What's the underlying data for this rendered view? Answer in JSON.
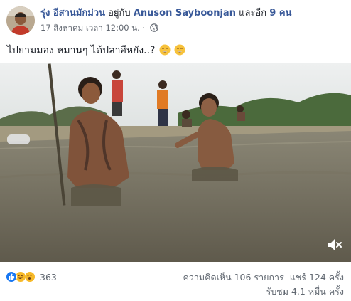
{
  "post": {
    "author": "รุ่ง อีสานมักม่วน",
    "with_text": "อยู่กับ",
    "tagged_name": "Anuson Sayboonjan",
    "and_text": "และอีก",
    "others_link": "9 คน",
    "timestamp": "17 สิงหาคม เวลา 12:00 น. ·",
    "privacy_icon": "globe-icon",
    "text": "ไปยามมอง หมานๆ ได้ปลาอีหยัง..?"
  },
  "video": {
    "mute_icon": "speaker-muted-icon"
  },
  "footer": {
    "reaction_icons": [
      "like-icon",
      "haha-icon",
      "wow-icon"
    ],
    "reaction_count": "363",
    "comments": "ความคิดเห็น 106 รายการ",
    "shares": "แชร์ 124 ครั้ง",
    "views": "รับชม 4.1 หมื่น ครั้ง"
  },
  "colors": {
    "link": "#385898",
    "secondary_text": "#616770",
    "like_blue": "#1877f2",
    "haha_yellow": "#f7b928"
  }
}
